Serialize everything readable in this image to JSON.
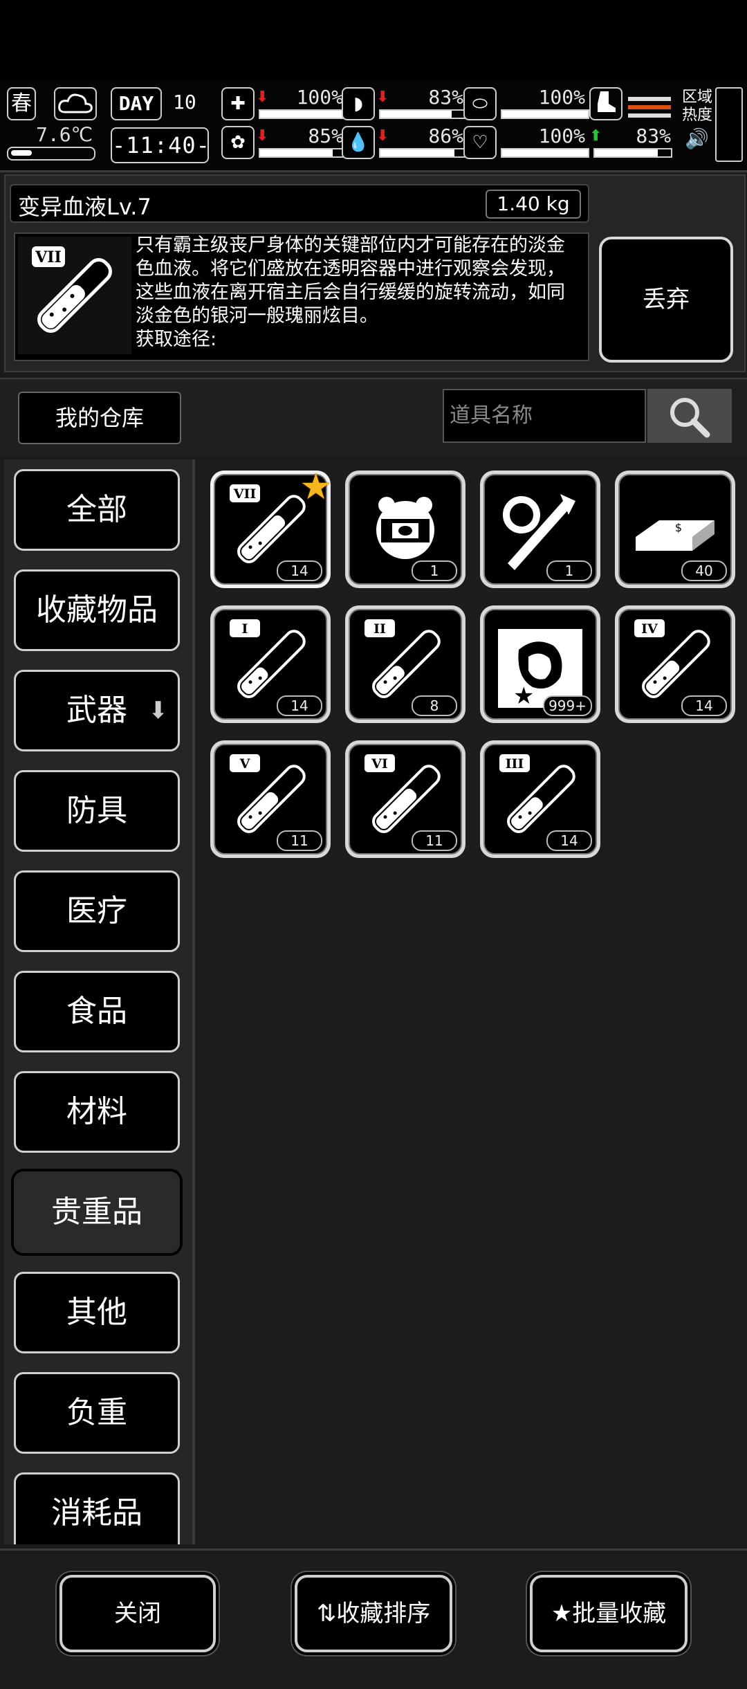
{
  "status": {
    "season": "春",
    "weather_icon": "cloud-icon",
    "temperature": "7.6℃",
    "day_label": "DAY",
    "day_number": "10",
    "clock": "-11:40-",
    "stats": [
      {
        "icon": "medkit-icon",
        "arrow": "down",
        "value": "100%",
        "level": 1.0
      },
      {
        "icon": "stomach-icon",
        "arrow": "down",
        "value": "83%",
        "level": 0.83
      },
      {
        "icon": "pill-icon",
        "arrow": "",
        "value": "100%",
        "level": 1.0
      },
      {
        "icon": "brain-icon",
        "arrow": "down",
        "value": "85%",
        "level": 0.85
      },
      {
        "icon": "water-drop-icon",
        "arrow": "down",
        "value": "86%",
        "level": 0.86
      },
      {
        "icon": "heart-icon",
        "arrow": "",
        "value": "100%",
        "level": 1.0
      },
      {
        "icon": "boot-icon",
        "arrow": "up",
        "value": "83%",
        "level": 0.83
      }
    ],
    "region_heat_label": "区域\n热度",
    "sound_icon": "speaker-icon"
  },
  "item_info": {
    "name": "变异血液Lv.7",
    "weight": "1.40 kg",
    "description": "只有霸主级丧尸身体的关键部位内才可能存在的淡金色血液。将它们盛放在透明容器中进行观察会发现，这些血液在离开宿主后会自行缓缓的旋转流动，如同淡金色的银河一般瑰丽炫目。",
    "source_label": "获取途径:",
    "discard_label": "丢弃",
    "icon_numeral": "VII"
  },
  "warehouse": {
    "title": "我的仓库",
    "search_placeholder": "道具名称"
  },
  "categories": [
    {
      "label": "全部",
      "active": false
    },
    {
      "label": "收藏物品",
      "active": false
    },
    {
      "label": "武器",
      "active": false,
      "has_dropdown": true
    },
    {
      "label": "防具",
      "active": false
    },
    {
      "label": "医疗",
      "active": false
    },
    {
      "label": "食品",
      "active": false
    },
    {
      "label": "材料",
      "active": false
    },
    {
      "label": "贵重品",
      "active": true
    },
    {
      "label": "其他",
      "active": false
    },
    {
      "label": "负重",
      "active": false
    },
    {
      "label": "消耗品",
      "active": false
    }
  ],
  "items": [
    {
      "icon": "blood-vial-icon",
      "numeral": "VII",
      "count": "14",
      "selected": true,
      "favorite": true,
      "fill": 0.75
    },
    {
      "icon": "bear-badge-icon",
      "count": "1"
    },
    {
      "icon": "horn-relic-icon",
      "count": "1"
    },
    {
      "icon": "cash-stack-icon",
      "count": "40"
    },
    {
      "icon": "blood-vial-icon",
      "numeral": "I",
      "count": "14",
      "fill": 0.25
    },
    {
      "icon": "blood-vial-icon",
      "numeral": "II",
      "count": "8",
      "fill": 0.3
    },
    {
      "icon": "zombie-photo-icon",
      "count": "999+"
    },
    {
      "icon": "blood-vial-icon",
      "numeral": "IV",
      "count": "14",
      "fill": 0.45
    },
    {
      "icon": "blood-vial-icon",
      "numeral": "V",
      "count": "11",
      "fill": 0.55
    },
    {
      "icon": "blood-vial-icon",
      "numeral": "VI",
      "count": "11",
      "fill": 0.65
    },
    {
      "icon": "blood-vial-icon",
      "numeral": "III",
      "count": "14",
      "fill": 0.4
    }
  ],
  "bottom": {
    "close_label": "关闭",
    "sort_label": "收藏排序",
    "batch_label": "批量收藏"
  }
}
